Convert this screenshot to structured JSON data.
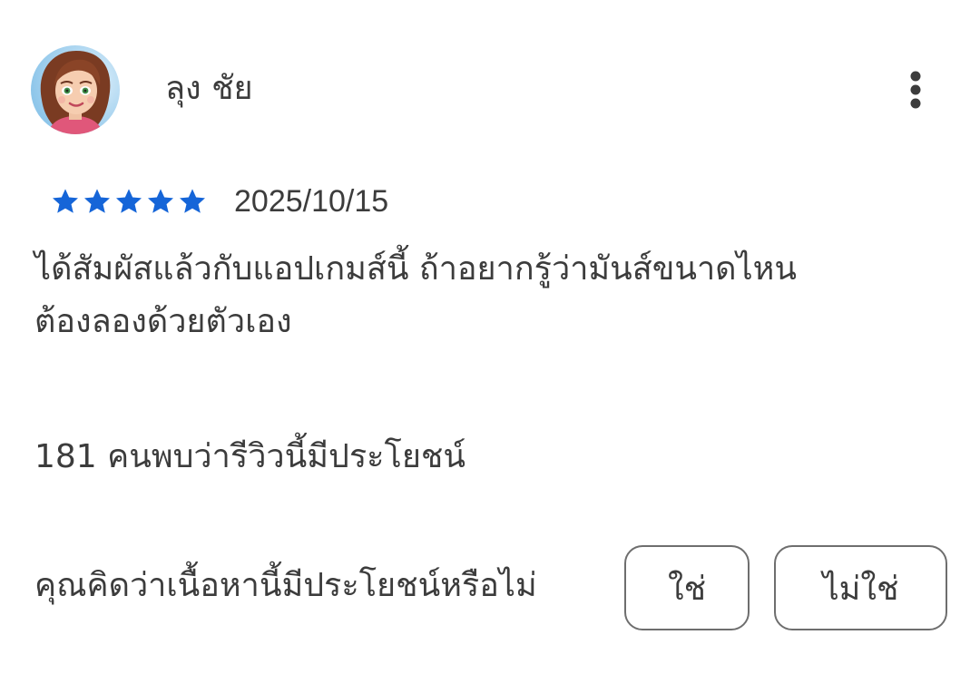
{
  "reviewer": {
    "name": "ลุง ชัย",
    "avatar_icon": "user-avatar-icon"
  },
  "menu": {
    "icon": "more-vertical-icon"
  },
  "rating": {
    "stars": 5,
    "max": 5,
    "color": "#1565d8"
  },
  "review": {
    "date": "2025/10/15",
    "text_lines": [
      "ได้สัมผัสแล้วกับแอปเกมส์นี้ ถ้าอยากรู้ว่ามันส์ขนาดไหน",
      "ต้องลองด้วยตัวเอง"
    ]
  },
  "helpful": {
    "count_text": "181 คนพบว่ารีวิวนี้มีประโยชน์",
    "question": "คุณคิดว่าเนื้อหานี้มีประโยชน์หรือไม่",
    "yes_label": "ใช่",
    "no_label": "ไม่ใช่"
  }
}
